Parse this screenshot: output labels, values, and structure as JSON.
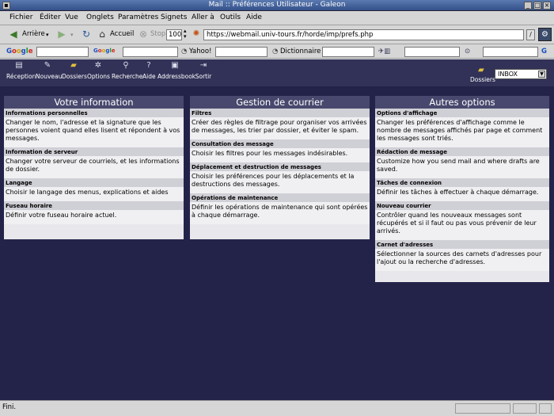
{
  "window": {
    "title": "Mail :: Préférences Utilisateur - Galeon"
  },
  "menubar": {
    "items": [
      "Fichier",
      "Éditer",
      "Vue",
      "Onglets",
      "Paramètres",
      "Signets",
      "Aller à",
      "Outils",
      "Aide"
    ]
  },
  "navbar": {
    "back_label": "Arrière",
    "home_label": "Accueil",
    "stop_label": "Stop",
    "zoom_value": "100",
    "url": "https://webmail.univ-tours.fr/horde/imp/prefs.php"
  },
  "searchbar": {
    "yahoo_label": "Yahoo!",
    "dictionary_label": "Dictionnaire"
  },
  "horde_toolbar": {
    "buttons": [
      "Réception",
      "Nouveau",
      "Dossiers",
      "Options",
      "Recherche",
      "Aide",
      "Addressbook",
      "Sortir"
    ],
    "folders_label": "Dossiers",
    "folder_selected": "INBOX"
  },
  "panels": [
    {
      "heading": "Votre information",
      "sections": [
        {
          "title": "Informations personnelles",
          "desc": "Changer le nom, l'adresse et la signature que les personnes voient quand elles lisent et répondent à vos messages."
        },
        {
          "title": "Information de serveur",
          "desc": "Changer votre serveur de courriels, et les informations de dossier."
        },
        {
          "title": "Langage",
          "desc": "Choisir le langage des menus, explications et aides"
        },
        {
          "title": "Fuseau horaire",
          "desc": "Définir votre fuseau horaire actuel."
        }
      ]
    },
    {
      "heading": "Gestion de courrier",
      "sections": [
        {
          "title": "Filtres",
          "desc": "Créer des règles de filtrage pour organiser vos arrivées de messages, les trier par dossier, et éviter le spam."
        },
        {
          "title": "Consultation des message",
          "desc": "Choisir les filtres pour les messages indésirables."
        },
        {
          "title": "Déplacement et destruction de messages",
          "desc": "Choisir les préférences pour les déplacements et la destructions des messages."
        },
        {
          "title": "Opérations de maintenance",
          "desc": "Définir les opérations de maintenance qui sont opérées à chaque démarrage."
        }
      ]
    },
    {
      "heading": "Autres options",
      "sections": [
        {
          "title": "Options d'affichage",
          "desc": "Changer les préférences d'affichage comme le nombre de messages affichés par page et comment les messages sont triés."
        },
        {
          "title": "Rédaction de message",
          "desc": "Customize how you send mail and where drafts are saved."
        },
        {
          "title": "Tâches de connexion",
          "desc": "Définir les tâches à effectuer à chaque démarrage."
        },
        {
          "title": "Nouveau courrier",
          "desc": "Contrôler quand les nouveaux messages sont récupérés et si il faut ou pas vous prévenir de leur arrivés."
        },
        {
          "title": "Carnet d'adresses",
          "desc": "Sélectionner la sources des carnets d'adresses pour l'ajout ou la recherche d'adresses."
        }
      ]
    }
  ],
  "status": {
    "text": "Fini."
  }
}
